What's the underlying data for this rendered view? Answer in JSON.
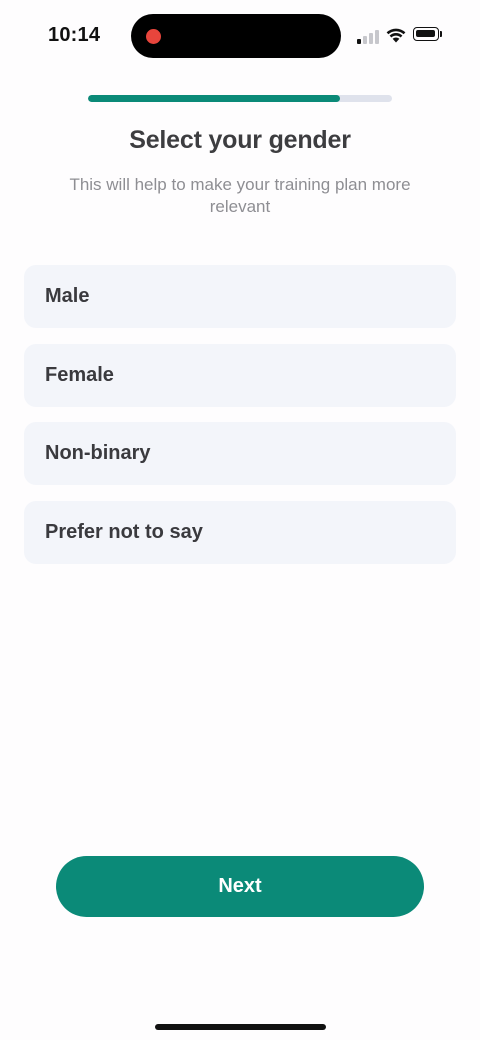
{
  "status_bar": {
    "time": "10:14",
    "icons": [
      "recording-dot-icon",
      "cellular-signal-icon",
      "wifi-icon",
      "battery-icon"
    ],
    "recording_color": "#e8453c"
  },
  "progress": {
    "value": 0.83,
    "fill_color": "#0b8a78",
    "track_color": "#dfe2ec"
  },
  "header": {
    "title": "Select your gender",
    "subtitle": "This will help to make your training plan more relevant"
  },
  "options": [
    {
      "label": "Male"
    },
    {
      "label": "Female"
    },
    {
      "label": "Non-binary"
    },
    {
      "label": "Prefer not to say"
    }
  ],
  "footer": {
    "next_label": "Next",
    "accent_color": "#0b8a78"
  }
}
